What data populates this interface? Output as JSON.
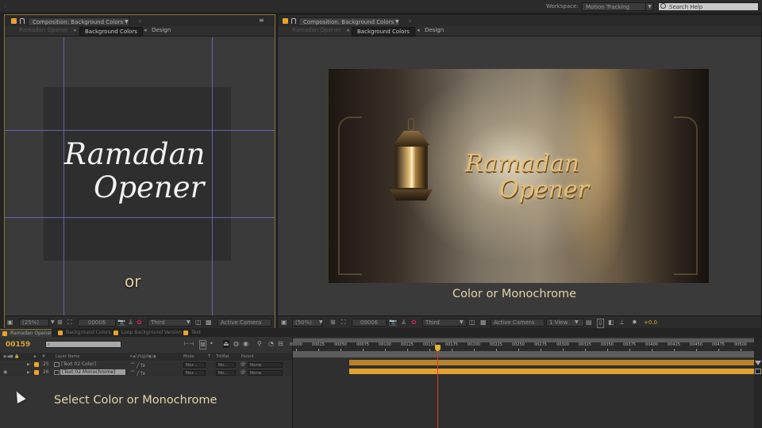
{
  "topbar": {
    "workspace_label": "Workspace:",
    "workspace_value": "Motion Tracking",
    "search_placeholder": "Search Help"
  },
  "left_viewer": {
    "tab_title": "Composition: Background Colors",
    "breadcrumbs": [
      "Ramadan Opener",
      "Background Colors",
      "Design"
    ],
    "active_breadcrumb": "Background Colors",
    "title_line1": "Ramadan",
    "title_line2": "Opener",
    "overlay_text": "or",
    "toolbar": {
      "magnification": "(25%)",
      "timecode": "00006",
      "resolution": "Third",
      "camera": "Active Camera"
    }
  },
  "right_viewer": {
    "tab_title": "Composition: Background Colors",
    "breadcrumbs": [
      "Ramadan Opener",
      "Background Colors",
      "Design"
    ],
    "active_breadcrumb": "Background Colors",
    "title_line1": "Ramadan",
    "title_line2": "Opener",
    "caption": "Color or Monochrome",
    "toolbar": {
      "magnification": "(50%)",
      "timecode": "00006",
      "resolution": "Third",
      "camera": "Active Camera",
      "views": "1 View",
      "exposure": "+0.0"
    }
  },
  "timeline": {
    "tabs": [
      {
        "label": "Ramadan Opener",
        "active": true
      },
      {
        "label": "Background Colors",
        "active": false
      },
      {
        "label": "Loop Background Version",
        "active": false
      },
      {
        "label": "Text",
        "active": false
      }
    ],
    "current_frame": "00159",
    "search_placeholder": "",
    "columns": {
      "layer_name": "Layer Name",
      "mode": "Mode",
      "t": "T",
      "trkmat": "TrkMat",
      "parent": "Parent"
    },
    "layers": [
      {
        "number": "25",
        "name": "[Text 02 Color]",
        "mode": "Nor...",
        "trkmat": "No...",
        "parent": "None",
        "selected": false
      },
      {
        "number": "26",
        "name": "[Text 02 Monochrome]",
        "mode": "Nor...",
        "trkmat": "No...",
        "parent": "None",
        "selected": true
      }
    ],
    "ruler_ticks": [
      "00000",
      "00025",
      "00050",
      "00075",
      "00100",
      "00125",
      "00150",
      "00175",
      "00200",
      "00225",
      "00250",
      "00275",
      "00300",
      "00325",
      "00350",
      "00375",
      "00400",
      "00425",
      "00450",
      "00475",
      "00500"
    ],
    "playhead_frame": 159,
    "bars_start_frame": 60,
    "instruction_text": "Select Color or Monochrome"
  },
  "colors": {
    "accent": "#e8a42b",
    "guide": "#6e6cc8",
    "playhead": "#e03a2a",
    "caption": "#e4d4ad"
  }
}
